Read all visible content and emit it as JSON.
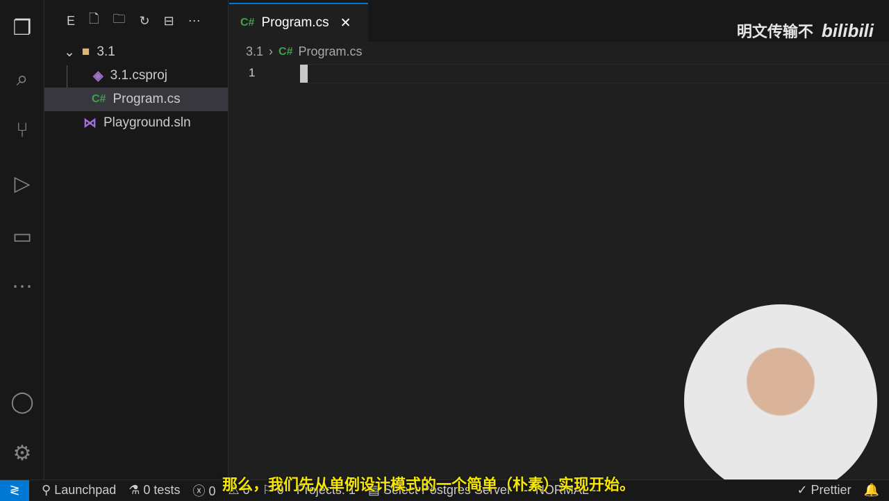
{
  "explorer": {
    "title": "E",
    "folder": "3.1",
    "files": [
      {
        "name": "3.1.csproj",
        "icon": "csproj-icon"
      },
      {
        "name": "Program.cs",
        "icon": "csharp-icon"
      }
    ],
    "solution": "Playground.sln"
  },
  "editor": {
    "tab": "Program.cs",
    "breadcrumb": [
      "3.1",
      "Program.cs"
    ],
    "line_number": "1",
    "cs_glyph": "C#"
  },
  "status": {
    "launchpad": "Launchpad",
    "tests": "0 tests",
    "errors": "0",
    "warnings": "0",
    "info": "0",
    "projects": "Projects: 1",
    "postgres": "Select Postgres Server",
    "mode": "-- NORMAL --",
    "prettier": "Prettier"
  },
  "overlay": {
    "watermark": "明文传输不",
    "logo": "bilibili",
    "subtitle": "那么，我们先从单例设计模式的一个简单（朴素）实现开始。"
  },
  "colors": {
    "accent": "#0078d4",
    "csharp": "#3ea34a"
  }
}
